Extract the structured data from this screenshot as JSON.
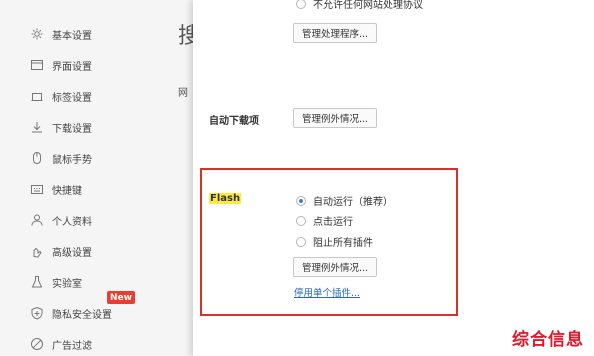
{
  "sidebar": {
    "items": [
      {
        "label": "基本设置",
        "icon": "gear-icon"
      },
      {
        "label": "界面设置",
        "icon": "window-icon"
      },
      {
        "label": "标签设置",
        "icon": "tab-icon"
      },
      {
        "label": "下载设置",
        "icon": "download-icon"
      },
      {
        "label": "鼠标手势",
        "icon": "mouse-icon"
      },
      {
        "label": "快捷键",
        "icon": "keyboard-icon"
      },
      {
        "label": "个人资料",
        "icon": "person-icon"
      },
      {
        "label": "高级设置",
        "icon": "advanced-icon"
      },
      {
        "label": "实验室",
        "icon": "flask-icon"
      },
      {
        "label": "隐私安全设置",
        "icon": "shield-icon"
      },
      {
        "label": "广告过滤",
        "icon": "block-icon"
      }
    ],
    "new_badge": "New"
  },
  "background": {
    "title_peek": "搜",
    "section_peek": "网"
  },
  "panel": {
    "protocol_option_label": "不允许任何网站处理协议",
    "manage_handlers_button": "管理处理程序...",
    "auto_download": {
      "label": "自动下载项",
      "manage_exceptions_button": "管理例外情况..."
    },
    "flash": {
      "label": "Flash",
      "options": [
        {
          "label": "自动运行（推荐）",
          "checked": true
        },
        {
          "label": "点击运行",
          "checked": false
        },
        {
          "label": "阻止所有插件",
          "checked": false
        }
      ],
      "manage_exceptions_button": "管理例外情况...",
      "disable_plugin_link": "停用单个插件..."
    }
  },
  "watermark": "综合信息",
  "colors": {
    "highlight_box": "#d9302a",
    "flash_highlight": "#ffeb3b",
    "badge": "#e84030",
    "link": "#2a66c4",
    "watermark": "#e0182c"
  }
}
